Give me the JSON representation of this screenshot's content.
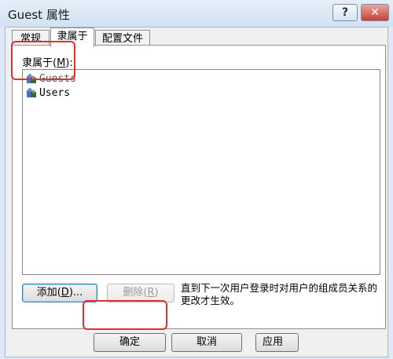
{
  "window": {
    "title": "Guest 属性",
    "help_label": "?",
    "close_label": "✕"
  },
  "tabs": [
    {
      "label": "常规",
      "active": false
    },
    {
      "label": "隶属于",
      "active": true
    },
    {
      "label": "配置文件",
      "active": false
    }
  ],
  "member_of": {
    "label_prefix": "隶属于(",
    "label_mnemonic": "M",
    "label_suffix": "):",
    "items": [
      {
        "label": "Guests",
        "icon": "users-group-icon"
      },
      {
        "label": "Users",
        "icon": "users-group-icon"
      }
    ]
  },
  "buttons": {
    "add_prefix": "添加(",
    "add_mnemonic": "D",
    "add_suffix": ")...",
    "remove_prefix": "删除(",
    "remove_mnemonic": "R",
    "remove_suffix": ")",
    "ok": "确定",
    "cancel": "取消",
    "apply": "应用(A)"
  },
  "note": "直到下一次用户登录时对用户的组成员关系的更改才生效。",
  "colors": {
    "highlight": "#d9342f",
    "close": "#c4413a"
  }
}
